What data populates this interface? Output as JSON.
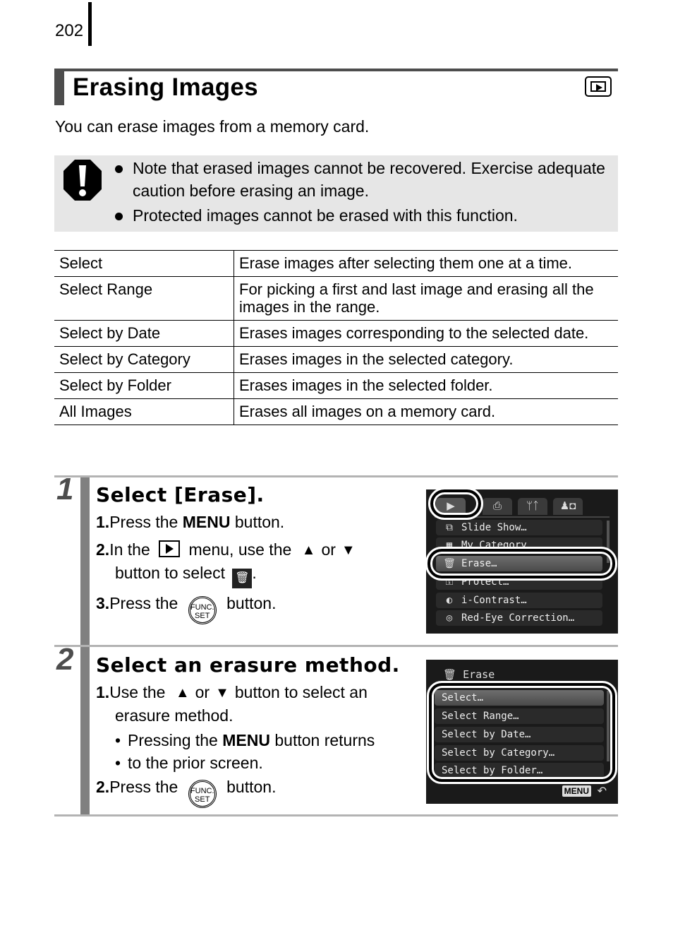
{
  "page_number": "202",
  "section": {
    "title": "Erasing Images",
    "mode_icon": "playback-icon",
    "intro": "You can erase images from a memory card."
  },
  "caution": {
    "icon": "caution-icon",
    "items": [
      "Note that erased images cannot be recovered. Exercise adequate caution before erasing an image.",
      "Protected images cannot be erased with this function."
    ]
  },
  "methods_table": {
    "rows": [
      {
        "method": "Select",
        "description": "Erase images after selecting them one at a time."
      },
      {
        "method": "Select Range",
        "description": "For picking a first and last image and erasing all the images in the range."
      },
      {
        "method": "Select by Date",
        "description": "Erases images corresponding to the selected date."
      },
      {
        "method": "Select by Category",
        "description": "Erases images in the selected category."
      },
      {
        "method": "Select by Folder",
        "description": "Erases images in the selected folder."
      },
      {
        "method": "All Images",
        "description": "Erases all images on a memory card."
      }
    ]
  },
  "steps": [
    {
      "number": "1",
      "heading": "Select [Erase].",
      "instructions": {
        "i1_num": "1.",
        "i1_pre": "Press the ",
        "i1_bold": "MENU",
        "i1_post": " button.",
        "i2_num": "2.",
        "i2_pre": "In the ",
        "i2_mid": " menu, use the ",
        "i2_or": "or",
        "i2_line2": "button to select ",
        "i2_end": ".",
        "i3_num": "3.",
        "i3_pre": "Press the ",
        "i3_post": " button."
      },
      "screen": {
        "tabs": [
          "▶",
          "⎙",
          "ᛘᛏ",
          "♟◘"
        ],
        "items": [
          {
            "icon": "⧉",
            "label": "Slide Show…"
          },
          {
            "icon": "▦",
            "label": "My Category"
          },
          {
            "icon": "🗑",
            "label": "Erase…",
            "selected": true
          },
          {
            "icon": "⚿",
            "label": "Protect…"
          },
          {
            "icon": "◐",
            "label": "i-Contrast…"
          },
          {
            "icon": "◎",
            "label": "Red-Eye Correction…"
          }
        ]
      }
    },
    {
      "number": "2",
      "heading": "Select an erasure method.",
      "instructions": {
        "i1_num": "1.",
        "i1_pre": "Use the ",
        "i1_or": "or",
        "i1_post": "button to select an",
        "i1_line2": "erasure method.",
        "bullet_pre": "Pressing the ",
        "bullet_bold": "MENU",
        "bullet_post": " button returns",
        "bullet_line2": "to the prior screen.",
        "i2_num": "2.",
        "i2_pre": "Press the ",
        "i2_post": " button."
      },
      "screen": {
        "title": "Erase",
        "items": [
          {
            "label": "Select…",
            "selected": true
          },
          {
            "label": "Select Range…"
          },
          {
            "label": "Select by Date…"
          },
          {
            "label": "Select by Category…"
          },
          {
            "label": "Select by Folder…"
          }
        ],
        "menu_badge": "MENU",
        "back_icon": "↶"
      }
    }
  ],
  "func_button": {
    "line1": "FUNC.",
    "line2": "SET"
  },
  "arrows": {
    "up": "▲",
    "down": "▼"
  }
}
